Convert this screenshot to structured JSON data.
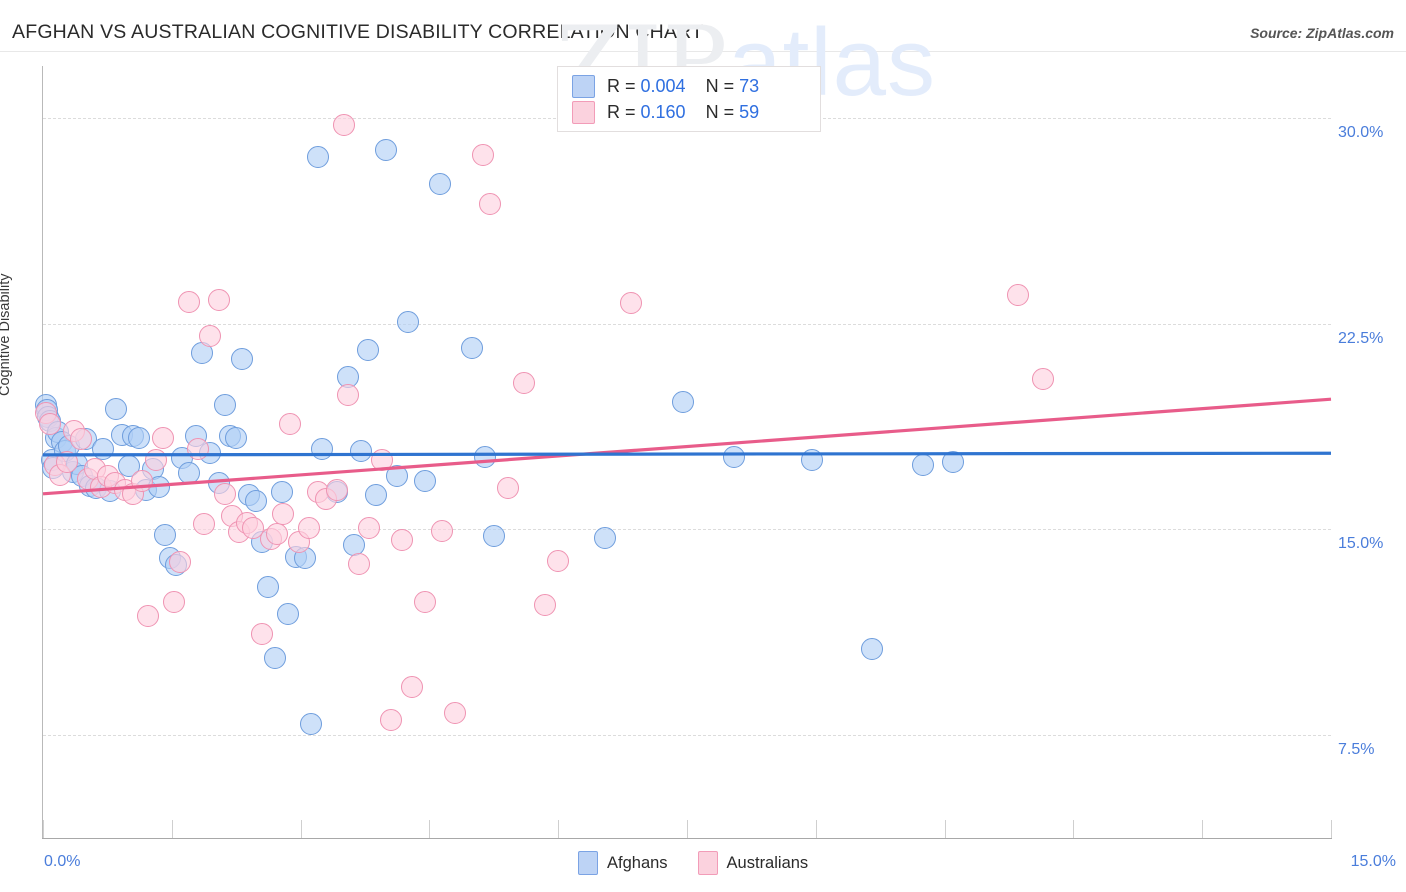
{
  "header": {
    "title": "AFGHAN VS AUSTRALIAN COGNITIVE DISABILITY CORRELATION CHART",
    "source": "Source: ZipAtlas.com"
  },
  "watermark": {
    "part1": "ZIP",
    "part2": "atlas"
  },
  "stats": {
    "rows": [
      {
        "series": "Afghans",
        "r_prefix": "R = ",
        "r": "0.004",
        "n_prefix": "N = ",
        "n": "73",
        "color": "#bdd3f5"
      },
      {
        "series": "Australians",
        "r_prefix": "R = ",
        "r": "0.160",
        "n_prefix": "N = ",
        "n": "59",
        "color": "#fbd2de"
      }
    ]
  },
  "legend": {
    "items": [
      {
        "label": "Afghans",
        "color": "#bdd3f5",
        "border": "#7ba3e4"
      },
      {
        "label": "Australians",
        "color": "#fbd2de",
        "border": "#f29cb8"
      }
    ]
  },
  "chart_data": {
    "type": "scatter",
    "title": "AFGHAN VS AUSTRALIAN COGNITIVE DISABILITY CORRELATION CHART",
    "xlabel": "",
    "ylabel": "Cognitive Disability",
    "xlim": [
      0.0,
      15.0
    ],
    "ylim": [
      3.75,
      31.9
    ],
    "grid": true,
    "legend_position": "bottom-center",
    "xticks": [
      "0.0%",
      "15.0%"
    ],
    "xtick_values": [
      0.0,
      15.0
    ],
    "yticks": [
      "30.0%",
      "22.5%",
      "15.0%",
      "7.5%"
    ],
    "ytick_values": [
      30.0,
      22.5,
      15.0,
      7.5
    ],
    "colors": {
      "afghans": "#7ba3e4",
      "australians": "#e85c8a"
    },
    "series": [
      {
        "name": "Afghans",
        "r": 0.004,
        "n": 73,
        "marker_color": "#b0cef5",
        "marker_border": "#6e9ddd",
        "trendline": {
          "x0": 0.0,
          "y0": 17.72,
          "x1": 15.0,
          "y1": 17.78
        },
        "points": [
          [
            0.03,
            19.55
          ],
          [
            0.05,
            19.35
          ],
          [
            0.06,
            19.1
          ],
          [
            0.08,
            18.95
          ],
          [
            0.1,
            17.55
          ],
          [
            0.12,
            17.25
          ],
          [
            0.15,
            18.35
          ],
          [
            0.18,
            18.55
          ],
          [
            0.22,
            18.2
          ],
          [
            0.26,
            17.85
          ],
          [
            0.3,
            18.05
          ],
          [
            0.35,
            17.1
          ],
          [
            0.4,
            17.4
          ],
          [
            0.45,
            16.95
          ],
          [
            0.5,
            18.3
          ],
          [
            0.55,
            16.6
          ],
          [
            0.62,
            16.5
          ],
          [
            0.7,
            17.95
          ],
          [
            0.78,
            16.4
          ],
          [
            0.85,
            19.4
          ],
          [
            0.92,
            18.45
          ],
          [
            1.0,
            17.3
          ],
          [
            1.05,
            18.4
          ],
          [
            1.12,
            18.35
          ],
          [
            1.2,
            16.45
          ],
          [
            1.28,
            17.2
          ],
          [
            1.35,
            16.55
          ],
          [
            1.42,
            14.8
          ],
          [
            1.48,
            13.95
          ],
          [
            1.55,
            13.7
          ],
          [
            1.62,
            17.6
          ],
          [
            1.7,
            17.05
          ],
          [
            1.78,
            18.4
          ],
          [
            1.85,
            21.45
          ],
          [
            1.95,
            17.8
          ],
          [
            2.05,
            16.7
          ],
          [
            2.12,
            19.55
          ],
          [
            2.18,
            18.4
          ],
          [
            2.25,
            18.35
          ],
          [
            2.32,
            21.2
          ],
          [
            2.4,
            16.25
          ],
          [
            2.48,
            16.05
          ],
          [
            2.55,
            14.55
          ],
          [
            2.62,
            12.9
          ],
          [
            2.7,
            10.3
          ],
          [
            2.78,
            16.35
          ],
          [
            2.85,
            11.9
          ],
          [
            2.95,
            14.0
          ],
          [
            3.05,
            13.95
          ],
          [
            3.12,
            7.9
          ],
          [
            3.2,
            28.6
          ],
          [
            3.25,
            17.95
          ],
          [
            3.42,
            16.35
          ],
          [
            3.55,
            20.55
          ],
          [
            3.62,
            14.45
          ],
          [
            3.7,
            17.85
          ],
          [
            3.78,
            21.55
          ],
          [
            3.88,
            16.25
          ],
          [
            4.0,
            28.85
          ],
          [
            4.12,
            16.95
          ],
          [
            4.25,
            22.55
          ],
          [
            4.45,
            16.75
          ],
          [
            4.62,
            27.6
          ],
          [
            5.0,
            21.6
          ],
          [
            5.15,
            17.65
          ],
          [
            5.25,
            14.75
          ],
          [
            6.55,
            14.7
          ],
          [
            7.45,
            19.65
          ],
          [
            8.05,
            17.65
          ],
          [
            8.95,
            17.55
          ],
          [
            10.25,
            17.35
          ],
          [
            10.6,
            17.45
          ],
          [
            9.65,
            10.65
          ]
        ]
      },
      {
        "name": "Australians",
        "r": 0.16,
        "n": 59,
        "marker_color": "#fdd0de",
        "marker_border": "#ef93b2",
        "trendline": {
          "x0": 0.0,
          "y0": 16.3,
          "x1": 15.0,
          "y1": 19.75
        },
        "points": [
          [
            0.04,
            19.25
          ],
          [
            0.08,
            18.85
          ],
          [
            0.14,
            17.35
          ],
          [
            0.2,
            17.0
          ],
          [
            0.28,
            17.45
          ],
          [
            0.36,
            18.6
          ],
          [
            0.44,
            18.3
          ],
          [
            0.52,
            16.85
          ],
          [
            0.6,
            17.2
          ],
          [
            0.68,
            16.55
          ],
          [
            0.76,
            16.95
          ],
          [
            0.84,
            16.7
          ],
          [
            0.95,
            16.45
          ],
          [
            1.05,
            16.3
          ],
          [
            1.15,
            16.75
          ],
          [
            1.22,
            11.85
          ],
          [
            1.32,
            17.55
          ],
          [
            1.4,
            18.35
          ],
          [
            1.52,
            12.35
          ],
          [
            1.6,
            13.8
          ],
          [
            1.7,
            23.3
          ],
          [
            1.8,
            17.95
          ],
          [
            1.88,
            15.2
          ],
          [
            1.95,
            22.05
          ],
          [
            2.05,
            23.35
          ],
          [
            2.12,
            16.3
          ],
          [
            2.2,
            15.5
          ],
          [
            2.28,
            14.9
          ],
          [
            2.38,
            15.25
          ],
          [
            2.45,
            15.05
          ],
          [
            2.55,
            11.2
          ],
          [
            2.65,
            14.65
          ],
          [
            2.72,
            14.85
          ],
          [
            2.8,
            15.55
          ],
          [
            2.88,
            18.85
          ],
          [
            2.98,
            14.55
          ],
          [
            3.1,
            15.05
          ],
          [
            3.2,
            16.35
          ],
          [
            3.3,
            16.1
          ],
          [
            3.42,
            16.45
          ],
          [
            3.5,
            29.75
          ],
          [
            3.55,
            19.9
          ],
          [
            3.68,
            13.75
          ],
          [
            3.8,
            15.05
          ],
          [
            3.95,
            17.55
          ],
          [
            4.05,
            8.05
          ],
          [
            4.18,
            14.6
          ],
          [
            4.3,
            9.25
          ],
          [
            4.45,
            12.35
          ],
          [
            4.65,
            14.95
          ],
          [
            4.8,
            8.3
          ],
          [
            5.12,
            28.65
          ],
          [
            5.2,
            26.85
          ],
          [
            5.42,
            16.5
          ],
          [
            5.6,
            20.35
          ],
          [
            5.85,
            12.25
          ],
          [
            6.0,
            13.85
          ],
          [
            6.85,
            23.25
          ],
          [
            11.35,
            23.55
          ],
          [
            11.65,
            20.5
          ]
        ]
      }
    ]
  }
}
